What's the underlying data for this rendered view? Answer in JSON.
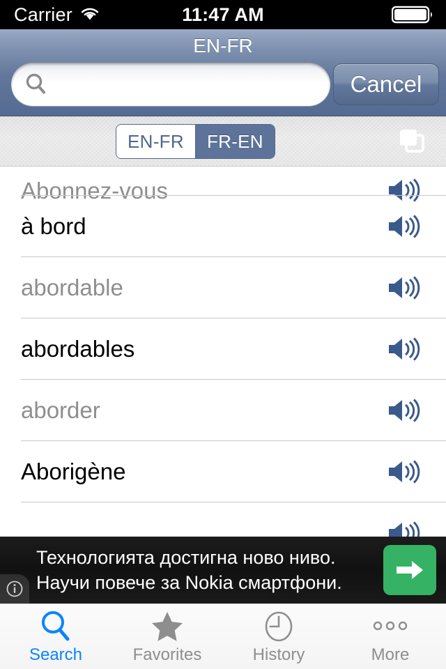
{
  "status_bar": {
    "carrier": "Carrier",
    "wifi_icon": "wifi-icon",
    "time": "11:47 AM",
    "battery_icon": "battery-full-icon"
  },
  "nav_bar": {
    "title": "EN-FR",
    "search": {
      "value": "",
      "placeholder": "",
      "icon": "search-icon"
    },
    "cancel_label": "Cancel"
  },
  "toolbar": {
    "segments": [
      {
        "label": "EN-FR",
        "selected": false
      },
      {
        "label": "FR-EN",
        "selected": true
      }
    ],
    "pages_icon": "pages-icon"
  },
  "list": {
    "items": [
      {
        "word": "Abonnez-vous",
        "style": "muted",
        "clipped": true,
        "speaker_icon": "speaker-icon"
      },
      {
        "word": "à bord",
        "style": "dark",
        "clipped": false,
        "speaker_icon": "speaker-icon"
      },
      {
        "word": "abordable",
        "style": "muted",
        "clipped": false,
        "speaker_icon": "speaker-icon"
      },
      {
        "word": "abordables",
        "style": "dark",
        "clipped": false,
        "speaker_icon": "speaker-icon"
      },
      {
        "word": "aborder",
        "style": "muted",
        "clipped": false,
        "speaker_icon": "speaker-icon"
      },
      {
        "word": "Aborigène",
        "style": "dark",
        "clipped": false,
        "speaker_icon": "speaker-icon"
      }
    ]
  },
  "ad": {
    "line1": "Технологията достигна ново ниво.",
    "line2": "Научи повече за Nokia смартфони.",
    "info_icon": "info-icon",
    "cta_icon": "arrow-right-icon"
  },
  "tab_bar": {
    "tabs": [
      {
        "label": "Search",
        "icon": "search-icon",
        "active": true
      },
      {
        "label": "Favorites",
        "icon": "star-icon",
        "active": false
      },
      {
        "label": "History",
        "icon": "clock-icon",
        "active": false
      },
      {
        "label": "More",
        "icon": "ellipsis-icon",
        "active": false
      }
    ]
  },
  "colors": {
    "accent_blue": "#0a84ff",
    "nav_blue": "#61769a",
    "segment_blue": "#5d739a",
    "speaker_blue": "#3b5a8c",
    "ad_green": "#35b263",
    "muted_gray": "#8e8e8e"
  }
}
